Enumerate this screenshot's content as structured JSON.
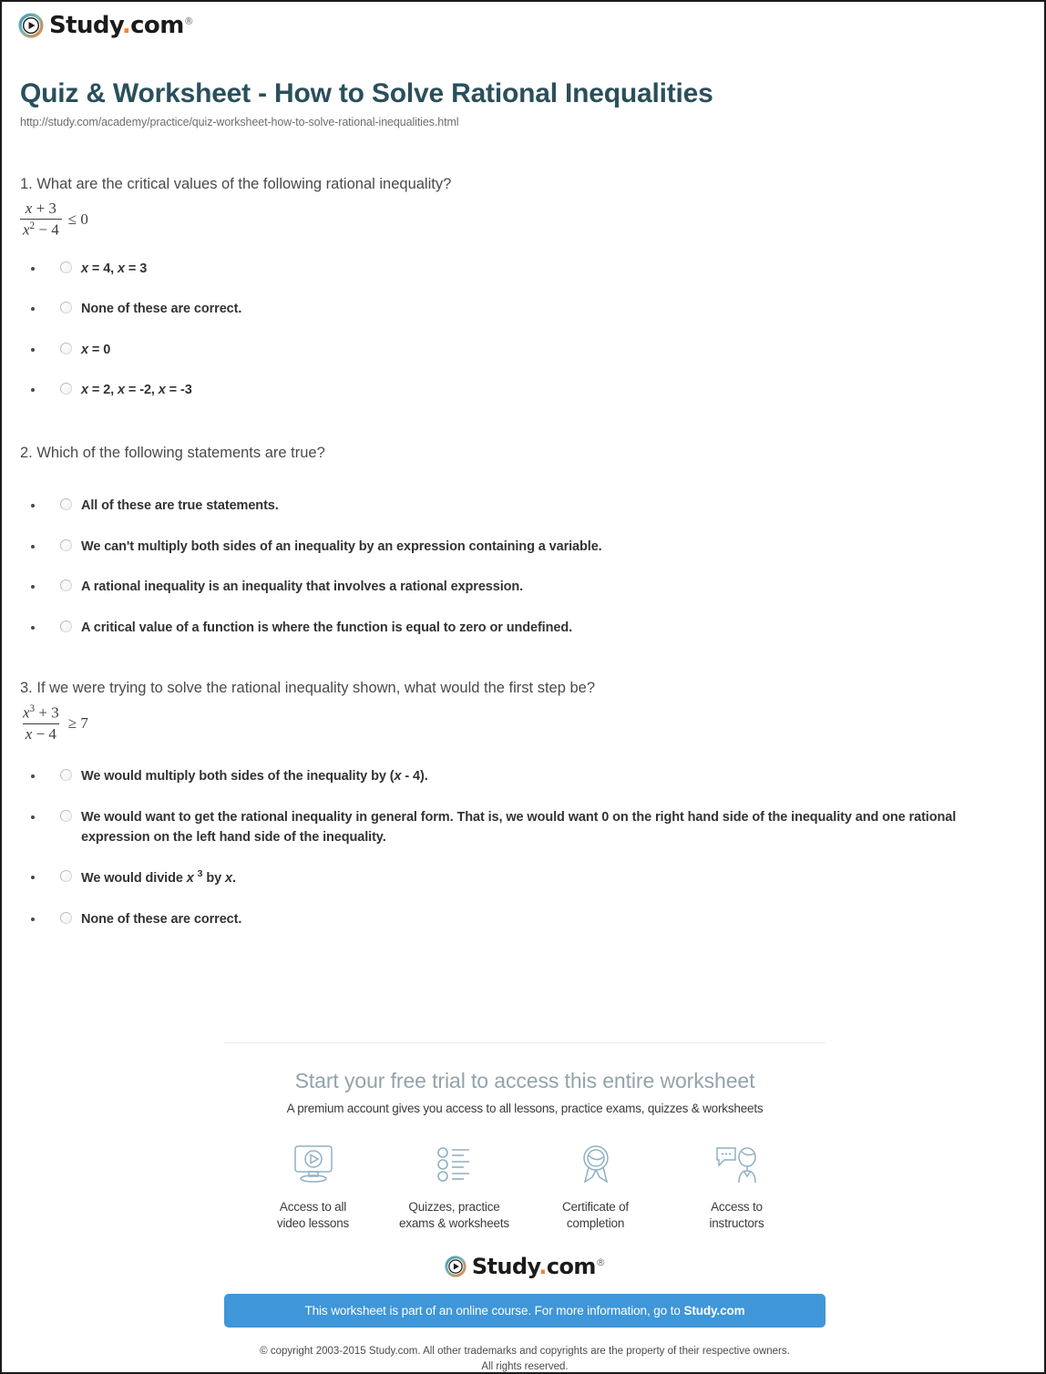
{
  "brand": {
    "name_main": "Study",
    "name_dot": ".",
    "name_tld": "com",
    "trademark": "®",
    "icon": "play-circle-icon",
    "ring_color_teal": "#3f9bb0",
    "ring_color_orange": "#e8863c"
  },
  "header": {
    "title": "Quiz & Worksheet - How to Solve Rational Inequalities",
    "url": "http://study.com/academy/practice/quiz-worksheet-how-to-solve-rational-inequalities.html",
    "title_color": "#2a4f5c"
  },
  "questions": [
    {
      "number": "1.",
      "text": "What are the critical values of the following rational inequality?",
      "math": {
        "numerator": "x + 3",
        "denominator": "x² − 4",
        "relation": "≤ 0"
      },
      "options": [
        {
          "text": "x = 4, x = 3",
          "radio": "radio-unchecked"
        },
        {
          "text": "None of these are correct.",
          "radio": "radio-unchecked"
        },
        {
          "text": "x = 0",
          "radio": "radio-unchecked"
        },
        {
          "text": "x = 2, x = -2, x = -3",
          "radio": "radio-unchecked"
        }
      ]
    },
    {
      "number": "2.",
      "text": "Which of the following statements are true?",
      "math": null,
      "options": [
        {
          "text": "All of these are true statements.",
          "radio": "radio-unchecked"
        },
        {
          "text": "We can't multiply both sides of an inequality by an expression containing a variable.",
          "radio": "radio-unchecked"
        },
        {
          "text": "A rational inequality is an inequality that involves a rational expression.",
          "radio": "radio-unchecked"
        },
        {
          "text": "A critical value of a function is where the function is equal to zero or undefined.",
          "radio": "radio-unchecked"
        }
      ]
    },
    {
      "number": "3.",
      "text": "If we were trying to solve the rational inequality shown, what would the first step be?",
      "math": {
        "numerator": "x³ + 3",
        "denominator": "x − 4",
        "relation": "≥ 7"
      },
      "options": [
        {
          "text": "We would multiply both sides of the inequality by (x - 4).",
          "radio": "radio-unchecked"
        },
        {
          "text": "We would want to get the rational inequality in general form. That is, we would want 0 on the right hand side of the inequality and one rational expression on the left hand side of the inequality.",
          "radio": "radio-unchecked"
        },
        {
          "text": "We would divide x 3 by x.",
          "radio": "radio-unchecked"
        },
        {
          "text": "None of these are correct.",
          "radio": "radio-unchecked"
        }
      ]
    }
  ],
  "promo": {
    "headline": "Start your free trial to access this entire worksheet",
    "subhead": "A premium account gives you access to all lessons, practice exams, quizzes & worksheets",
    "features": [
      {
        "icon": "monitor-play-icon",
        "label": "Access to all\nvideo lessons"
      },
      {
        "icon": "checklist-icon",
        "label": "Quizzes, practice\nexams & worksheets"
      },
      {
        "icon": "award-ribbon-icon",
        "label": "Certificate of\ncompletion"
      },
      {
        "icon": "instructor-chat-icon",
        "label": "Access to\ninstructors"
      }
    ],
    "cta_prefix": "This worksheet is part of an online course. For more information, go to ",
    "cta_link": "Study.com",
    "cta_color": "#3f96d8",
    "copyright_line1": "© copyright 2003-2015 Study.com. All other trademarks and copyrights are the property of their respective owners.",
    "copyright_line2": "All rights reserved."
  }
}
